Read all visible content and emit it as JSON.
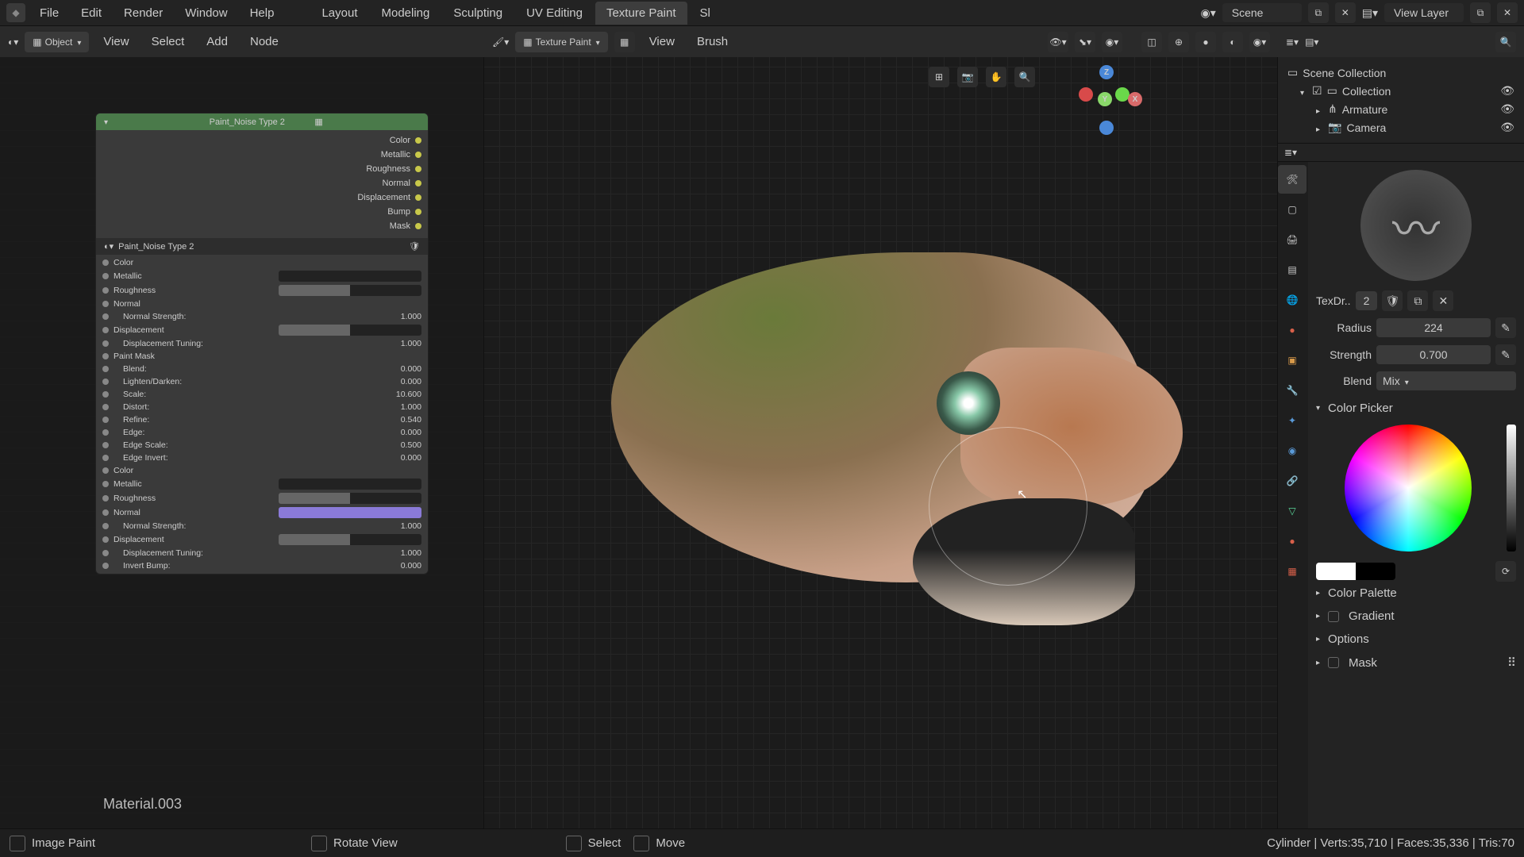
{
  "top": {
    "menus": [
      "File",
      "Edit",
      "Render",
      "Window",
      "Help"
    ],
    "workspaces": [
      "Layout",
      "Modeling",
      "Sculpting",
      "UV Editing",
      "Texture Paint",
      "Sl"
    ],
    "active_workspace": 4,
    "scene_label": "Scene",
    "view_layer_label": "View Layer"
  },
  "left_toolbar": {
    "mode": "Object",
    "menus": [
      "View",
      "Select",
      "Add",
      "Node"
    ]
  },
  "center_toolbar": {
    "paint_mode": "Texture Paint",
    "menus": [
      "View",
      "Brush"
    ]
  },
  "node": {
    "title": "Paint_Noise Type 2",
    "outputs": [
      "Color",
      "Metallic",
      "Roughness",
      "Normal",
      "Displacement",
      "Bump",
      "Mask"
    ],
    "sub_title": "Paint_Noise Type 2",
    "inputs": [
      {
        "label": "Color",
        "type": "socket"
      },
      {
        "label": "Metallic",
        "type": "bar-dark"
      },
      {
        "label": "Roughness",
        "type": "bar-mid"
      },
      {
        "label": "Normal",
        "type": "socket"
      },
      {
        "label": "Normal Strength:",
        "value": "1.000",
        "indent": true
      },
      {
        "label": "Displacement",
        "type": "bar-mid"
      },
      {
        "label": "Displacement Tuning:",
        "value": "1.000",
        "indent": true
      },
      {
        "label": "Paint Mask",
        "type": "socket"
      },
      {
        "label": "Blend:",
        "value": "0.000",
        "indent": true
      },
      {
        "label": "Lighten/Darken:",
        "value": "0.000",
        "indent": true
      },
      {
        "label": "Scale:",
        "value": "10.600",
        "indent": true
      },
      {
        "label": "Distort:",
        "value": "1.000",
        "indent": true
      },
      {
        "label": "Refine:",
        "value": "0.540",
        "indent": true
      },
      {
        "label": "Edge:",
        "value": "0.000",
        "indent": true
      },
      {
        "label": "Edge Scale:",
        "value": "0.500",
        "indent": true
      },
      {
        "label": "Edge Invert:",
        "value": "0.000",
        "indent": true
      },
      {
        "label": "Color",
        "type": "socket"
      },
      {
        "label": "Metallic",
        "type": "bar-dark"
      },
      {
        "label": "Roughness",
        "type": "bar-mid"
      },
      {
        "label": "Normal",
        "type": "bar-purple"
      },
      {
        "label": "Normal Strength:",
        "value": "1.000",
        "indent": true
      },
      {
        "label": "Displacement",
        "type": "bar-mid"
      },
      {
        "label": "Displacement Tuning:",
        "value": "1.000",
        "indent": true
      },
      {
        "label": "Invert Bump:",
        "value": "0.000",
        "indent": true
      }
    ],
    "material": "Material.003"
  },
  "outliner": {
    "scene_collection": "Scene Collection",
    "collection": "Collection",
    "items": [
      "Armature",
      "Camera"
    ]
  },
  "props": {
    "brush_name": "TexDr..",
    "brush_num": "2",
    "radius_label": "Radius",
    "radius_value": "224",
    "strength_label": "Strength",
    "strength_value": "0.700",
    "blend_label": "Blend",
    "blend_value": "Mix",
    "sections": {
      "color_picker": "Color Picker",
      "color_palette": "Color Palette",
      "gradient": "Gradient",
      "options": "Options",
      "mask": "Mask"
    }
  },
  "status": {
    "mode": "Image Paint",
    "rotate": "Rotate View",
    "select": "Select",
    "move": "Move",
    "stats": "Cylinder | Verts:35,710 | Faces:35,336 | Tris:70"
  },
  "axes": {
    "x": "X",
    "y": "Y",
    "z": "Z"
  }
}
